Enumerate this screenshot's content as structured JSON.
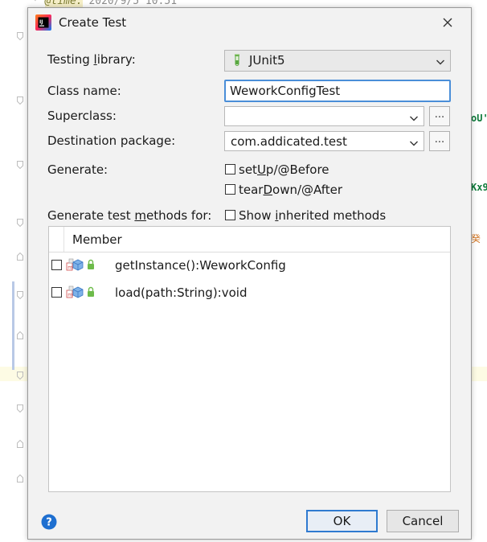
{
  "editor": {
    "top_line_prefix": "* ",
    "top_line_tag": "@time:",
    "top_line_rest": " 2020/9/5 10:51",
    "fragment_1": "oU'",
    "fragment_2": "Kx9",
    "fragment_3": "癸"
  },
  "dialog": {
    "title": "Create Test",
    "app_icon": "intellij-idea-icon",
    "fields": {
      "testing_library": {
        "label_pre": "Testing ",
        "label_mnemonic": "l",
        "label_post": "ibrary:",
        "value": "JUnit5",
        "icon": "junit-flask-icon"
      },
      "class_name": {
        "label": "Class name:",
        "value": "WeworkConfigTest"
      },
      "superclass": {
        "label": "Superclass:",
        "value": "",
        "browse_label": "..."
      },
      "destination_package": {
        "label": "Destination package:",
        "value": "com.addicated.test",
        "browse_label": "..."
      }
    },
    "generate": {
      "label": "Generate:",
      "setup_pre": "set",
      "setup_mnemonic": "U",
      "setup_post": "p/@Before",
      "setup_checked": false,
      "teardown_pre": "tear",
      "teardown_mnemonic": "D",
      "teardown_post": "own/@After",
      "teardown_checked": false
    },
    "methods": {
      "label_pre": "Generate test ",
      "label_mnemonic": "m",
      "label_post": "ethods for:",
      "show_inherited_pre": "Show ",
      "show_inherited_mnemonic": "i",
      "show_inherited_post": "nherited methods",
      "show_inherited_checked": false,
      "column_header": "Member",
      "rows": [
        {
          "signature": "getInstance():WeworkConfig",
          "checked": false
        },
        {
          "signature": "load(path:String):void",
          "checked": false
        }
      ]
    },
    "buttons": {
      "ok": "OK",
      "cancel": "Cancel",
      "help": "?"
    }
  },
  "colors": {
    "accent": "#2f7ad0",
    "dialog_bg": "#f2f2f2",
    "help_blue": "#1e6fd0"
  }
}
